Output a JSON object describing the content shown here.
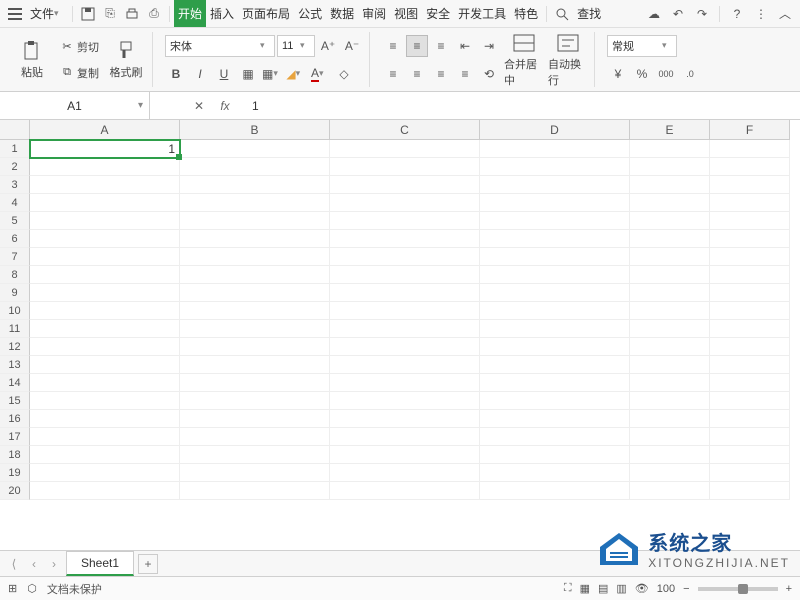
{
  "menubar": {
    "file_label": "文件",
    "search_label": "查找",
    "tabs": [
      "开始",
      "插入",
      "页面布局",
      "公式",
      "数据",
      "审阅",
      "视图",
      "安全",
      "开发工具",
      "特色"
    ],
    "active_tab_index": 0
  },
  "ribbon": {
    "paste_label": "粘贴",
    "cut_label": "剪切",
    "copy_label": "复制",
    "format_painter_label": "格式刷",
    "font_name": "宋体",
    "font_size": "11",
    "merge_label": "合并居中",
    "wrap_label": "自动换行",
    "number_format_label": "常规"
  },
  "namebox": {
    "value": "A1"
  },
  "formula": {
    "value": "1"
  },
  "grid": {
    "columns": [
      "A",
      "B",
      "C",
      "D",
      "E",
      "F"
    ],
    "row_count": 20,
    "active": {
      "row": 1,
      "col": 0
    },
    "cells": {
      "A1": "1"
    }
  },
  "sheet_tabs": {
    "active": "Sheet1"
  },
  "status": {
    "protect_label": "文档未保护",
    "zoom": "100"
  },
  "watermark": {
    "title": "系统之家",
    "url": "XITONGZHIJIA.NET"
  }
}
